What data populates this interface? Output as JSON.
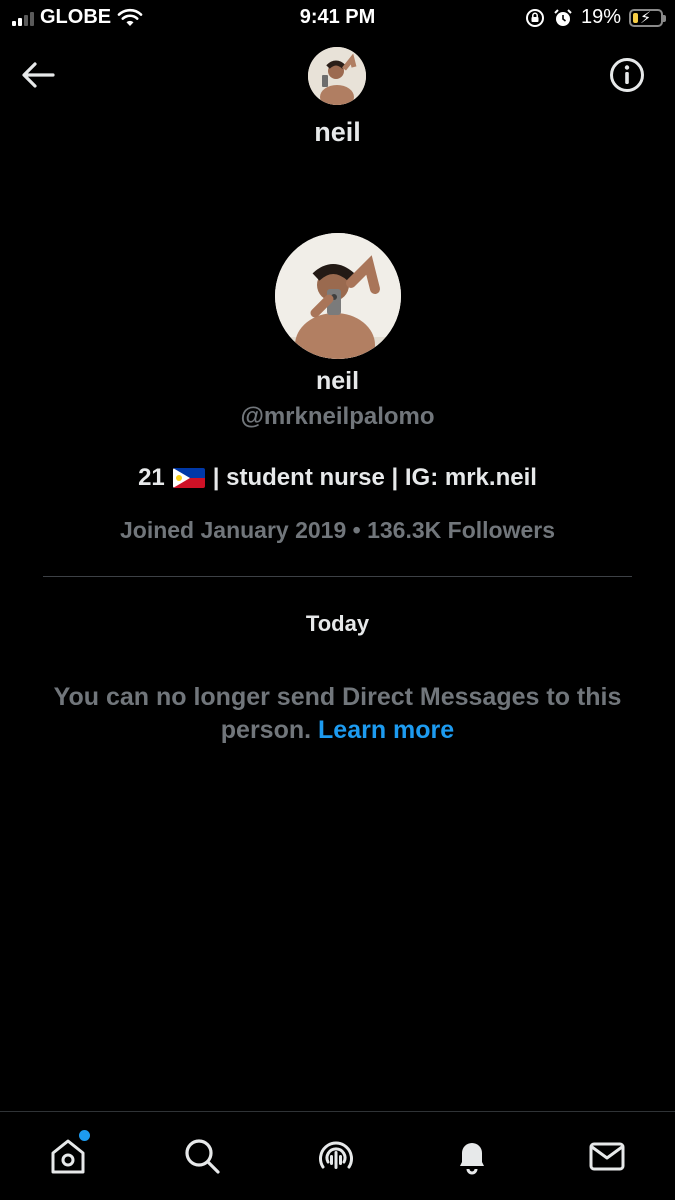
{
  "status_bar": {
    "carrier": "GLOBE",
    "time": "9:41 PM",
    "battery_percent": "19%",
    "battery_level": 0.19,
    "icons": [
      "signal-icon",
      "wifi-icon",
      "orientation-lock-icon",
      "alarm-icon",
      "battery-icon"
    ]
  },
  "header": {
    "name": "neil",
    "back_icon": "arrow-left-icon",
    "info_icon": "info-icon"
  },
  "profile": {
    "name": "neil",
    "handle": "@mrkneilpalomo",
    "bio_age": "21",
    "bio_rest": "| student nurse | IG: mrk.neil",
    "meta": "Joined January 2019 • 136.3K Followers"
  },
  "conversation": {
    "date_label": "Today",
    "notice_text": "You can no longer send Direct Messages to this person.",
    "learn_more": "Learn more"
  },
  "bottom_nav": {
    "items": [
      "home-icon",
      "search-icon",
      "spaces-icon",
      "notifications-icon",
      "messages-icon"
    ],
    "home_has_badge": true
  },
  "colors": {
    "background": "#000000",
    "primary_text": "#e7e9ea",
    "secondary_text": "#71767b",
    "accent": "#1d9bf0",
    "divider": "#3d4146"
  }
}
